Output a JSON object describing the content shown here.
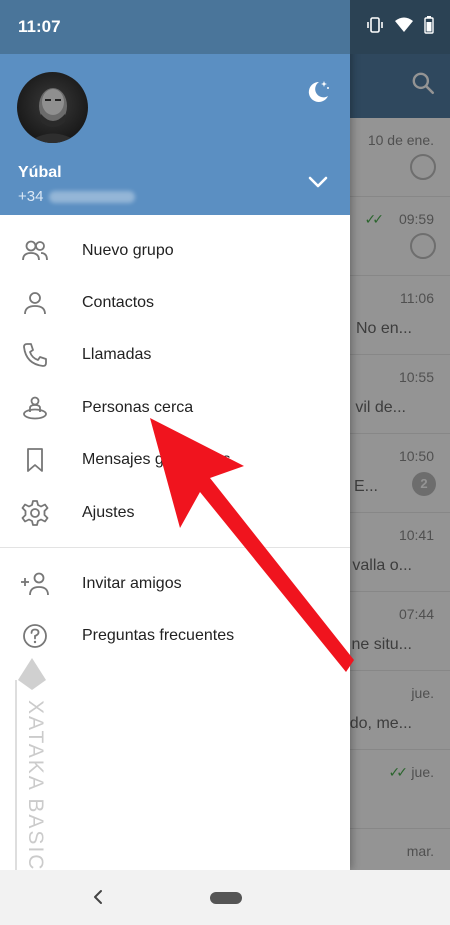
{
  "status_bar": {
    "time": "11:07"
  },
  "profile": {
    "name": "Yúbal",
    "phone_prefix": "+34"
  },
  "menu": [
    {
      "label": "Nuevo grupo",
      "icon": "group-icon"
    },
    {
      "label": "Contactos",
      "icon": "person-icon"
    },
    {
      "label": "Llamadas",
      "icon": "phone-icon"
    },
    {
      "label": "Personas cerca",
      "icon": "people-nearby-icon"
    },
    {
      "label": "Mensajes guardados",
      "icon": "bookmark-icon"
    },
    {
      "label": "Ajustes",
      "icon": "gear-icon"
    },
    {
      "label": "Invitar amigos",
      "icon": "add-person-icon"
    },
    {
      "label": "Preguntas frecuentes",
      "icon": "help-icon"
    }
  ],
  "chat_list": [
    {
      "time": "10 de ene.",
      "preview": "",
      "indicator": "pin"
    },
    {
      "time": "09:59",
      "preview": "",
      "indicator": "pin",
      "read": true
    },
    {
      "time": "11:06",
      "preview": "No en...",
      "indicator": ""
    },
    {
      "time": "10:55",
      "preview": "vil de...",
      "indicator": ""
    },
    {
      "time": "10:50",
      "preview": "E...",
      "indicator": "badge",
      "badge": "2"
    },
    {
      "time": "10:41",
      "preview": "valla o...",
      "indicator": ""
    },
    {
      "time": "07:44",
      "preview": "ne situ...",
      "indicator": ""
    },
    {
      "time": "jue.",
      "preview": "do, me...",
      "indicator": ""
    },
    {
      "time": "jue.",
      "preview": "",
      "indicator": "",
      "read": true
    },
    {
      "time": "mar.",
      "preview": "",
      "indicator": ""
    }
  ],
  "watermark": {
    "text": "XATAKA BASICS"
  },
  "colors": {
    "drawer_header": "#5b8fc2",
    "status_bar": "#4a759a",
    "arrow": "#f0141e",
    "read_check": "#4caf50"
  }
}
